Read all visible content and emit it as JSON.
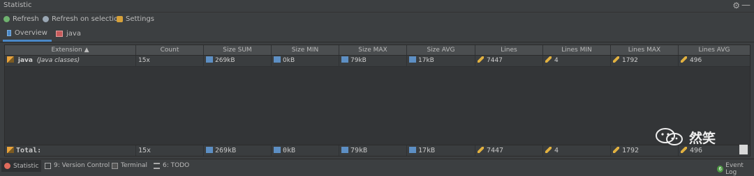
{
  "window": {
    "title": "Statistic"
  },
  "toolbar": {
    "refresh": "Refresh",
    "refresh_selection": "Refresh on selection",
    "settings": "Settings"
  },
  "tabs": [
    {
      "label": "Overview"
    },
    {
      "label": "java"
    }
  ],
  "table": {
    "columns": [
      "Extension",
      "Count",
      "Size SUM",
      "Size MIN",
      "Size MAX",
      "Size AVG",
      "Lines",
      "Lines MIN",
      "Lines MAX",
      "Lines AVG"
    ],
    "row": {
      "ext": "java",
      "ext_note": "(Java classes)",
      "count": "15x",
      "size_sum": "269kB",
      "size_min": "0kB",
      "size_max": "79kB",
      "size_avg": "17kB",
      "lines": "7447",
      "lines_min": "4",
      "lines_max": "1792",
      "lines_avg": "496"
    },
    "total": {
      "label": "Total:",
      "count": "15x",
      "size_sum": "269kB",
      "size_min": "0kB",
      "size_max": "79kB",
      "size_avg": "17kB",
      "lines": "7447",
      "lines_min": "4",
      "lines_max": "1792",
      "lines_avg": "496"
    }
  },
  "statusbar": {
    "statistic": "Statistic",
    "version_control": "9: Version Control",
    "terminal": "Terminal",
    "todo": "6: TODO",
    "event_log": "Event Log",
    "event_count": "6"
  },
  "watermark": {
    "text": "然笑"
  },
  "icons": {
    "gear": "gear-icon",
    "minimize": "minimize-icon",
    "refresh": "refresh-icon",
    "refresh_selection": "refresh-selection-icon",
    "settings": "settings-icon",
    "overview": "overview-icon",
    "java": "java-tab-icon",
    "file": "file-icon",
    "disk": "disk-icon",
    "pencil": "pencil-icon"
  },
  "colors": {
    "accent": "#4a88c7",
    "background": "#3c3f41",
    "table_bg": "#333537"
  }
}
